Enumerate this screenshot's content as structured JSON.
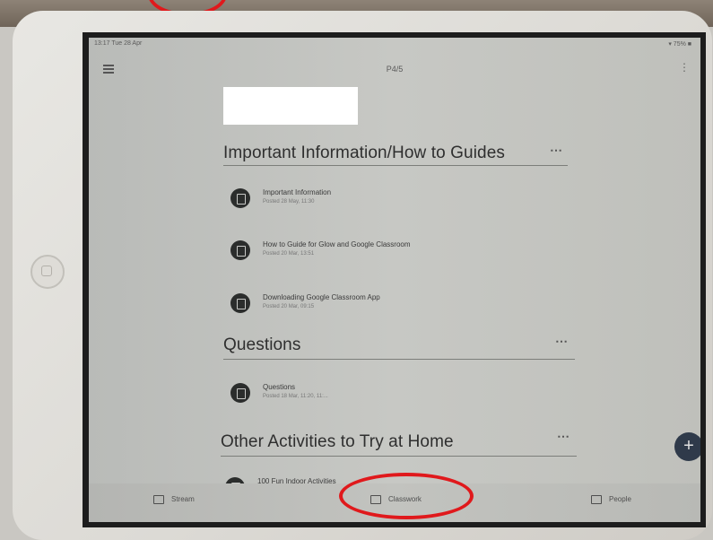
{
  "status_bar": {
    "time": "13:17  Tue 28 Apr",
    "right": "▾ 75% ■"
  },
  "header": {
    "class_title": "P4/5"
  },
  "sections": [
    {
      "title": "Important Information/How to Guides",
      "items": [
        {
          "title": "Important Information",
          "subtitle": "Posted 28 May, 11:30"
        },
        {
          "title": "How to Guide for Glow and Google Classroom",
          "subtitle": "Posted 20 Mar, 13:51"
        },
        {
          "title": "Downloading Google Classroom App",
          "subtitle": "Posted 20 Mar, 09:15"
        }
      ]
    },
    {
      "title": "Questions",
      "items": [
        {
          "title": "Questions",
          "subtitle": "Posted 18 Mar, 11:20, 11:..."
        }
      ]
    },
    {
      "title": "Other Activities to Try at Home",
      "items": [
        {
          "title": "100 Fun Indoor Activities",
          "subtitle": ""
        }
      ]
    }
  ],
  "fab": {
    "label": "+"
  },
  "bottom_nav": {
    "stream": "Stream",
    "classwork": "Classwork",
    "people": "People"
  },
  "colors": {
    "annotation": "#e0191c",
    "fab": "#2f3a4a"
  }
}
